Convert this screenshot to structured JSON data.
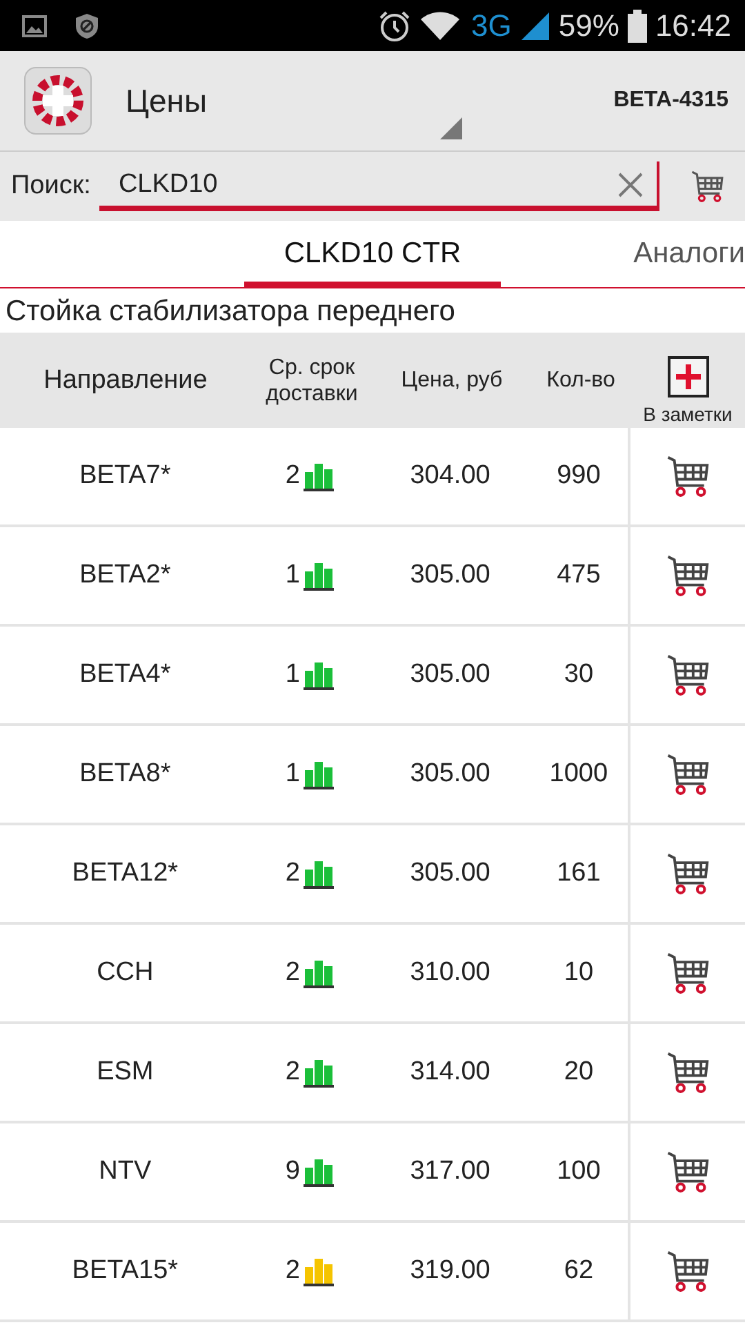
{
  "status_bar": {
    "battery": "59%",
    "time": "16:42",
    "network": "3G"
  },
  "app_bar": {
    "title": "Цены",
    "account": "BETA-4315"
  },
  "search": {
    "label": "Поиск:",
    "value": "CLKD10"
  },
  "tabs": [
    {
      "label": "CLKD10 CTR",
      "selected": true
    },
    {
      "label": "Аналоги",
      "selected": false
    }
  ],
  "part_name": "Стойка стабилизатора переднего",
  "table": {
    "columns": [
      "Направление",
      "Ср. срок доставки",
      "Цена, руб",
      "Кол-во",
      "В заметки"
    ],
    "rows": [
      {
        "direction": "BETA7*",
        "days": "2",
        "color": "#1bbf3a",
        "price": "304.00",
        "qty": "990"
      },
      {
        "direction": "BETA2*",
        "days": "1",
        "color": "#1bbf3a",
        "price": "305.00",
        "qty": "475"
      },
      {
        "direction": "BETA4*",
        "days": "1",
        "color": "#1bbf3a",
        "price": "305.00",
        "qty": "30"
      },
      {
        "direction": "BETA8*",
        "days": "1",
        "color": "#1bbf3a",
        "price": "305.00",
        "qty": "1000"
      },
      {
        "direction": "BETA12*",
        "days": "2",
        "color": "#1bbf3a",
        "price": "305.00",
        "qty": "161"
      },
      {
        "direction": "CCH",
        "days": "2",
        "color": "#1bbf3a",
        "price": "310.00",
        "qty": "10"
      },
      {
        "direction": "ESM",
        "days": "2",
        "color": "#1bbf3a",
        "price": "314.00",
        "qty": "20"
      },
      {
        "direction": "NTV",
        "days": "9",
        "color": "#1bbf3a",
        "price": "317.00",
        "qty": "100"
      },
      {
        "direction": "BETA15*",
        "days": "2",
        "color": "#f5c400",
        "price": "319.00",
        "qty": "62"
      }
    ]
  }
}
